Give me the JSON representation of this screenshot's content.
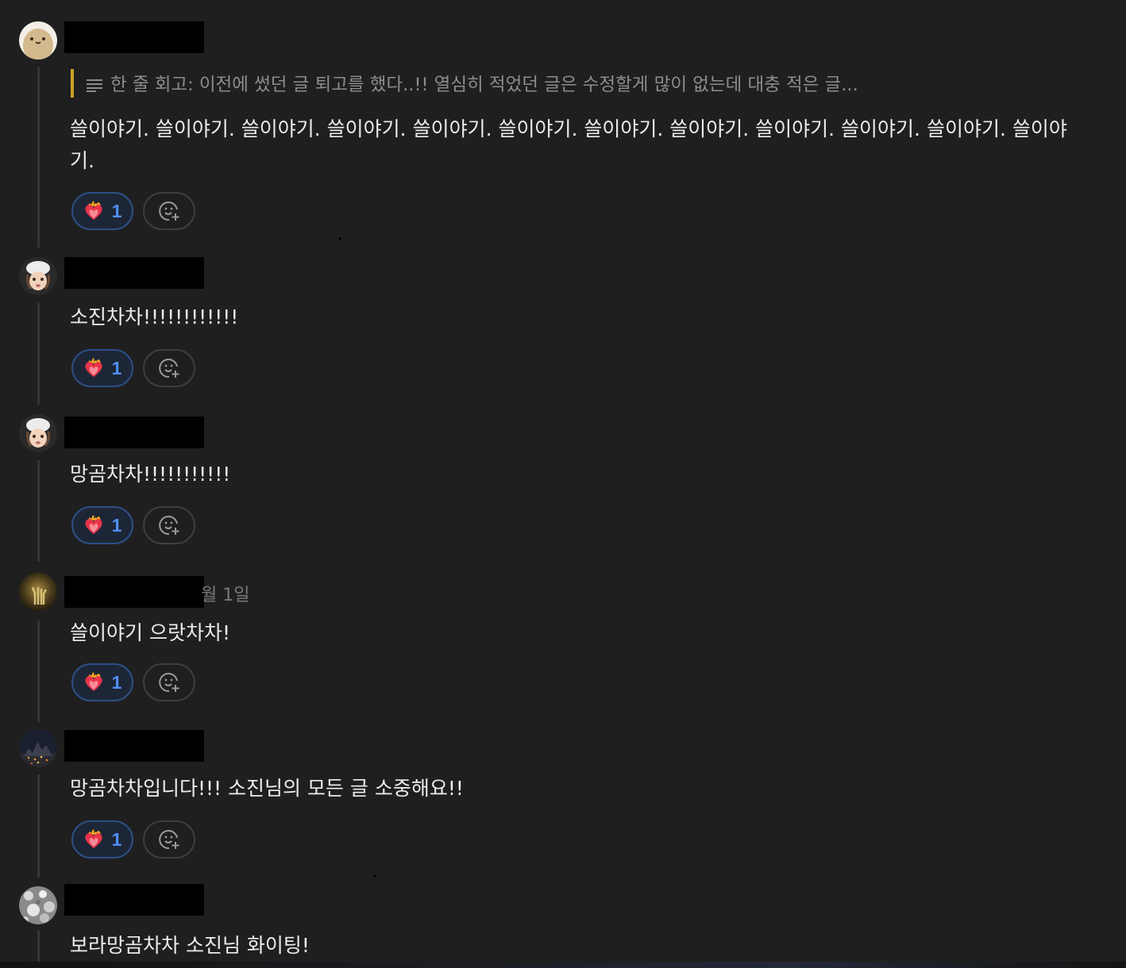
{
  "colors": {
    "background": "#1f1f1f",
    "quote_bar": "#c9a227",
    "reaction_border": "#2c4f86",
    "reaction_count": "#4f8ff5",
    "redaction": "#000000"
  },
  "comments": [
    {
      "avatar_icon": "potato-avatar-icon",
      "timestamp": "",
      "quote": "한 줄 회고: 이전에 썼던 글 퇴고를 했다..!! 열심히 적었던 글은 수정할게 많이 없는데 대충 적은 글...",
      "body_line1": "쓸이야기. 쓸이야기. 쓸이야기. 쓸이야기. 쓸이야기. 쓸이야기. 쓸이야기. 쓸이야기. 쓸이야기. 쓸이야기. 쓸이야기. 쓸이야",
      "body_line2": "기.",
      "reaction": {
        "emoji": "heart-on-fire-emoji",
        "count": "1"
      }
    },
    {
      "avatar_icon": "memoji-chef-avatar-icon",
      "timestamp": "",
      "body_line1": "소진차차!!!!!!!!!!!!",
      "reaction": {
        "emoji": "heart-on-fire-emoji",
        "count": "1"
      }
    },
    {
      "avatar_icon": "memoji-chef-avatar-icon",
      "timestamp": "",
      "body_line1": "망곰차차!!!!!!!!!!!",
      "reaction": {
        "emoji": "heart-on-fire-emoji",
        "count": "1"
      }
    },
    {
      "avatar_icon": "golden-hand-avatar-icon",
      "timestamp": "월 1일",
      "body_line1": "쓸이야기 으랏차차!",
      "reaction": {
        "emoji": "heart-on-fire-emoji",
        "count": "1"
      }
    },
    {
      "avatar_icon": "night-city-avatar-icon",
      "timestamp": "",
      "body_line1": "망곰차차입니다!!! 소진님의 모든 글 소중해요!!",
      "reaction": {
        "emoji": "heart-on-fire-emoji",
        "count": "1"
      }
    },
    {
      "avatar_icon": "gray-pattern-avatar-icon",
      "timestamp": "",
      "body_line1": "보라망곰차차 소진님 화이팅!"
    }
  ]
}
